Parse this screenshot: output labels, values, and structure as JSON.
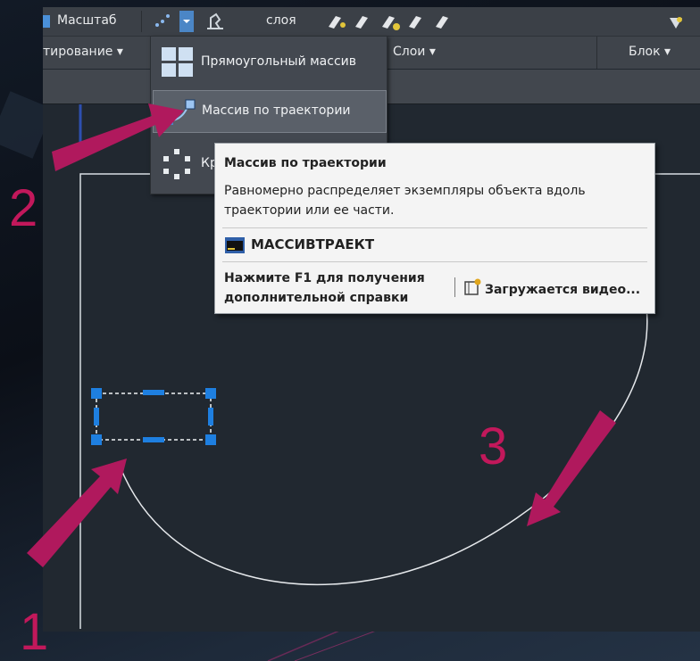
{
  "ribbon": {
    "row1": {
      "scale_label": "Масштаб",
      "layer_label": "слоя"
    },
    "row2": {
      "panel_left": "тирование ▾",
      "panel_layers": "Слои ▾",
      "panel_block": "Блок ▾"
    }
  },
  "menu": {
    "items": [
      {
        "label": "Прямоугольный массив",
        "icon": "rectangular-array-icon"
      },
      {
        "label": "Массив по траектории",
        "icon": "path-array-icon",
        "selected": true
      },
      {
        "label": "Кр",
        "icon": "polar-array-icon"
      }
    ]
  },
  "tooltip": {
    "title": "Массив по траектории",
    "description": "Равномерно распределяет экземпляры объекта вдоль траектории или ее части.",
    "command": "МАССИВТРАЕКТ",
    "help": "Нажмите F1 для получения дополнительной справки",
    "video": "Загружается видео..."
  },
  "steps": {
    "one": "1",
    "two": "2",
    "three": "3"
  },
  "colors": {
    "accent_arrow": "#b0195d",
    "grip_blue": "#1e7fe0",
    "canvas_bg": "#212830"
  }
}
